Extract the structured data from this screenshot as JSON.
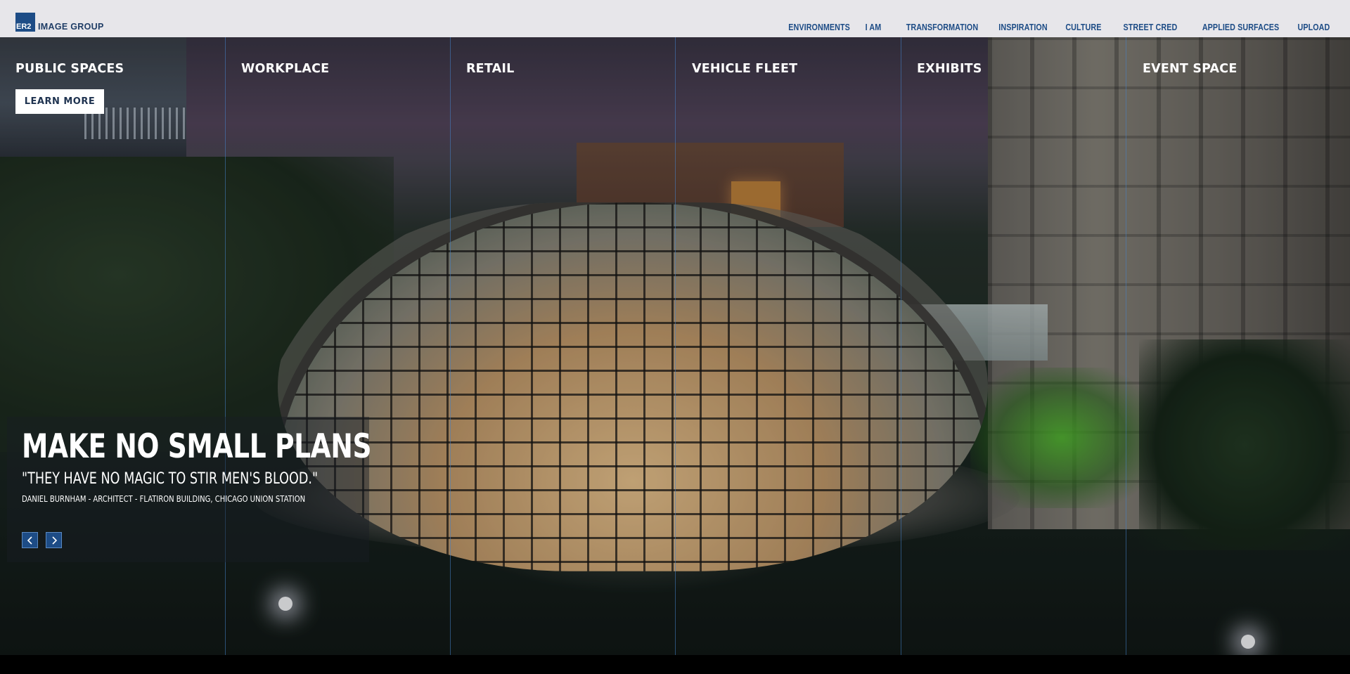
{
  "header": {
    "logo_mark": "ER2",
    "logo_text": "IMAGE GROUP",
    "nav": [
      {
        "label": "ENVIRONMENTS"
      },
      {
        "label": "I AM"
      },
      {
        "label": "TRANSFORMATION"
      },
      {
        "label": "INSPIRATION"
      },
      {
        "label": "CULTURE"
      },
      {
        "label": "STREET CRED"
      },
      {
        "label": "APPLIED SURFACES"
      },
      {
        "label": "UPLOAD"
      }
    ]
  },
  "hero": {
    "categories": [
      {
        "label": "PUBLIC SPACES"
      },
      {
        "label": "WORKPLACE"
      },
      {
        "label": "RETAIL"
      },
      {
        "label": "VEHICLE FLEET"
      },
      {
        "label": "EXHIBITS"
      },
      {
        "label": "EVENT SPACE"
      }
    ],
    "learn_more_label": "LEARN MORE",
    "headline": "MAKE NO SMALL PLANS",
    "subquote": "\"THEY HAVE NO MAGIC TO STIR MEN'S BLOOD.\"",
    "attribution": "DANIEL BURNHAM - ARCHITECT - FLATIRON BUILDING, CHICAGO UNION STATION",
    "prev_icon": "chevron-left-icon",
    "next_icon": "chevron-right-icon"
  },
  "colors": {
    "brand_blue": "#1d4c86",
    "header_bg": "#e7e6ea",
    "column_line": "#4682c8"
  }
}
